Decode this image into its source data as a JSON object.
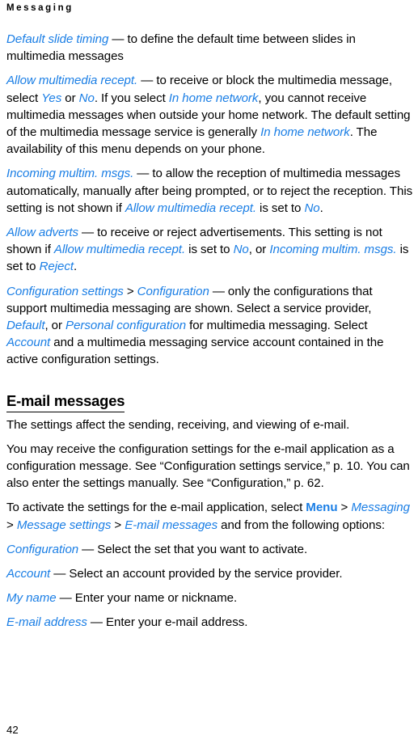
{
  "document": {
    "running_head": "Messaging",
    "page_number": "42",
    "accent_color": "#1a7ee5",
    "text_color": "#000000",
    "background_color": "#ffffff"
  },
  "body": {
    "paragraphs": [
      {
        "id": "default-slide-timing",
        "runs": [
          {
            "style": "term",
            "text": "Default slide timing"
          },
          {
            "style": "plain",
            "text": " — to define the default time between slides in multimedia messages"
          }
        ]
      },
      {
        "id": "allow-multimedia-recept",
        "runs": [
          {
            "style": "term",
            "text": "Allow multimedia recept."
          },
          {
            "style": "plain",
            "text": " — to receive or block the multimedia message, select "
          },
          {
            "style": "term",
            "text": "Yes"
          },
          {
            "style": "plain",
            "text": " or "
          },
          {
            "style": "term",
            "text": "No"
          },
          {
            "style": "plain",
            "text": ". If you select "
          },
          {
            "style": "term",
            "text": "In home network"
          },
          {
            "style": "plain",
            "text": ", you cannot receive multimedia messages when outside your home network. The default setting of the multimedia message service is generally "
          },
          {
            "style": "term",
            "text": "In home network"
          },
          {
            "style": "plain",
            "text": ". The availability of this menu depends on your phone."
          }
        ]
      },
      {
        "id": "incoming-multim-msgs",
        "runs": [
          {
            "style": "term",
            "text": "Incoming multim. msgs."
          },
          {
            "style": "plain",
            "text": " — to allow the reception of multimedia messages automatically, manually after being prompted, or to reject the reception. This setting is not shown if "
          },
          {
            "style": "term",
            "text": "Allow multimedia recept."
          },
          {
            "style": "plain",
            "text": " is set to "
          },
          {
            "style": "term",
            "text": "No"
          },
          {
            "style": "plain",
            "text": "."
          }
        ]
      },
      {
        "id": "allow-adverts",
        "runs": [
          {
            "style": "term",
            "text": "Allow adverts"
          },
          {
            "style": "plain",
            "text": " — to receive or reject advertisements. This setting is not shown if "
          },
          {
            "style": "term",
            "text": "Allow multimedia recept."
          },
          {
            "style": "plain",
            "text": " is set to "
          },
          {
            "style": "term",
            "text": "No"
          },
          {
            "style": "plain",
            "text": ", or "
          },
          {
            "style": "term",
            "text": "Incoming multim. msgs."
          },
          {
            "style": "plain",
            "text": " is set to "
          },
          {
            "style": "term",
            "text": "Reject"
          },
          {
            "style": "plain",
            "text": "."
          }
        ]
      },
      {
        "id": "configuration-settings",
        "runs": [
          {
            "style": "term",
            "text": "Configuration settings"
          },
          {
            "style": "plain",
            "text": " > "
          },
          {
            "style": "term",
            "text": "Configuration"
          },
          {
            "style": "plain",
            "text": " — only the configurations that support multimedia messaging are shown. Select a service provider, "
          },
          {
            "style": "term",
            "text": "Default"
          },
          {
            "style": "plain",
            "text": ", or "
          },
          {
            "style": "term",
            "text": "Personal configuration"
          },
          {
            "style": "plain",
            "text": " for multimedia messaging. Select "
          },
          {
            "style": "term",
            "text": "Account"
          },
          {
            "style": "plain",
            "text": " and a multimedia messaging service account contained in the active configuration settings."
          }
        ]
      }
    ],
    "section": {
      "heading": "E-mail messages",
      "paragraphs": [
        {
          "id": "email-intro",
          "runs": [
            {
              "style": "plain",
              "text": "The settings affect the sending, receiving, and viewing of e-mail."
            }
          ]
        },
        {
          "id": "email-config-message",
          "runs": [
            {
              "style": "plain",
              "text": "You may receive the configuration settings for the e-mail application as a configuration message. See “Configuration settings service,” p. 10. You can also enter the settings manually. See “Configuration,” p. 62."
            }
          ]
        },
        {
          "id": "email-activate",
          "runs": [
            {
              "style": "plain",
              "text": "To activate the settings for the e-mail application, select "
            },
            {
              "style": "key",
              "text": "Menu"
            },
            {
              "style": "plain",
              "text": " > "
            },
            {
              "style": "term",
              "text": "Messaging"
            },
            {
              "style": "plain",
              "text": " > "
            },
            {
              "style": "term",
              "text": "Message settings"
            },
            {
              "style": "plain",
              "text": " > "
            },
            {
              "style": "term",
              "text": "E-mail messages"
            },
            {
              "style": "plain",
              "text": " and from the following options:"
            }
          ]
        },
        {
          "id": "opt-configuration",
          "runs": [
            {
              "style": "term",
              "text": "Configuration"
            },
            {
              "style": "plain",
              "text": " — Select the set that you want to activate."
            }
          ]
        },
        {
          "id": "opt-account",
          "runs": [
            {
              "style": "term",
              "text": "Account"
            },
            {
              "style": "plain",
              "text": " — Select an account provided by the service provider."
            }
          ]
        },
        {
          "id": "opt-my-name",
          "runs": [
            {
              "style": "term",
              "text": "My name"
            },
            {
              "style": "plain",
              "text": " — Enter your name or nickname."
            }
          ]
        },
        {
          "id": "opt-email-address",
          "runs": [
            {
              "style": "term",
              "text": "E-mail address"
            },
            {
              "style": "plain",
              "text": " — Enter your e-mail address."
            }
          ]
        }
      ]
    }
  }
}
